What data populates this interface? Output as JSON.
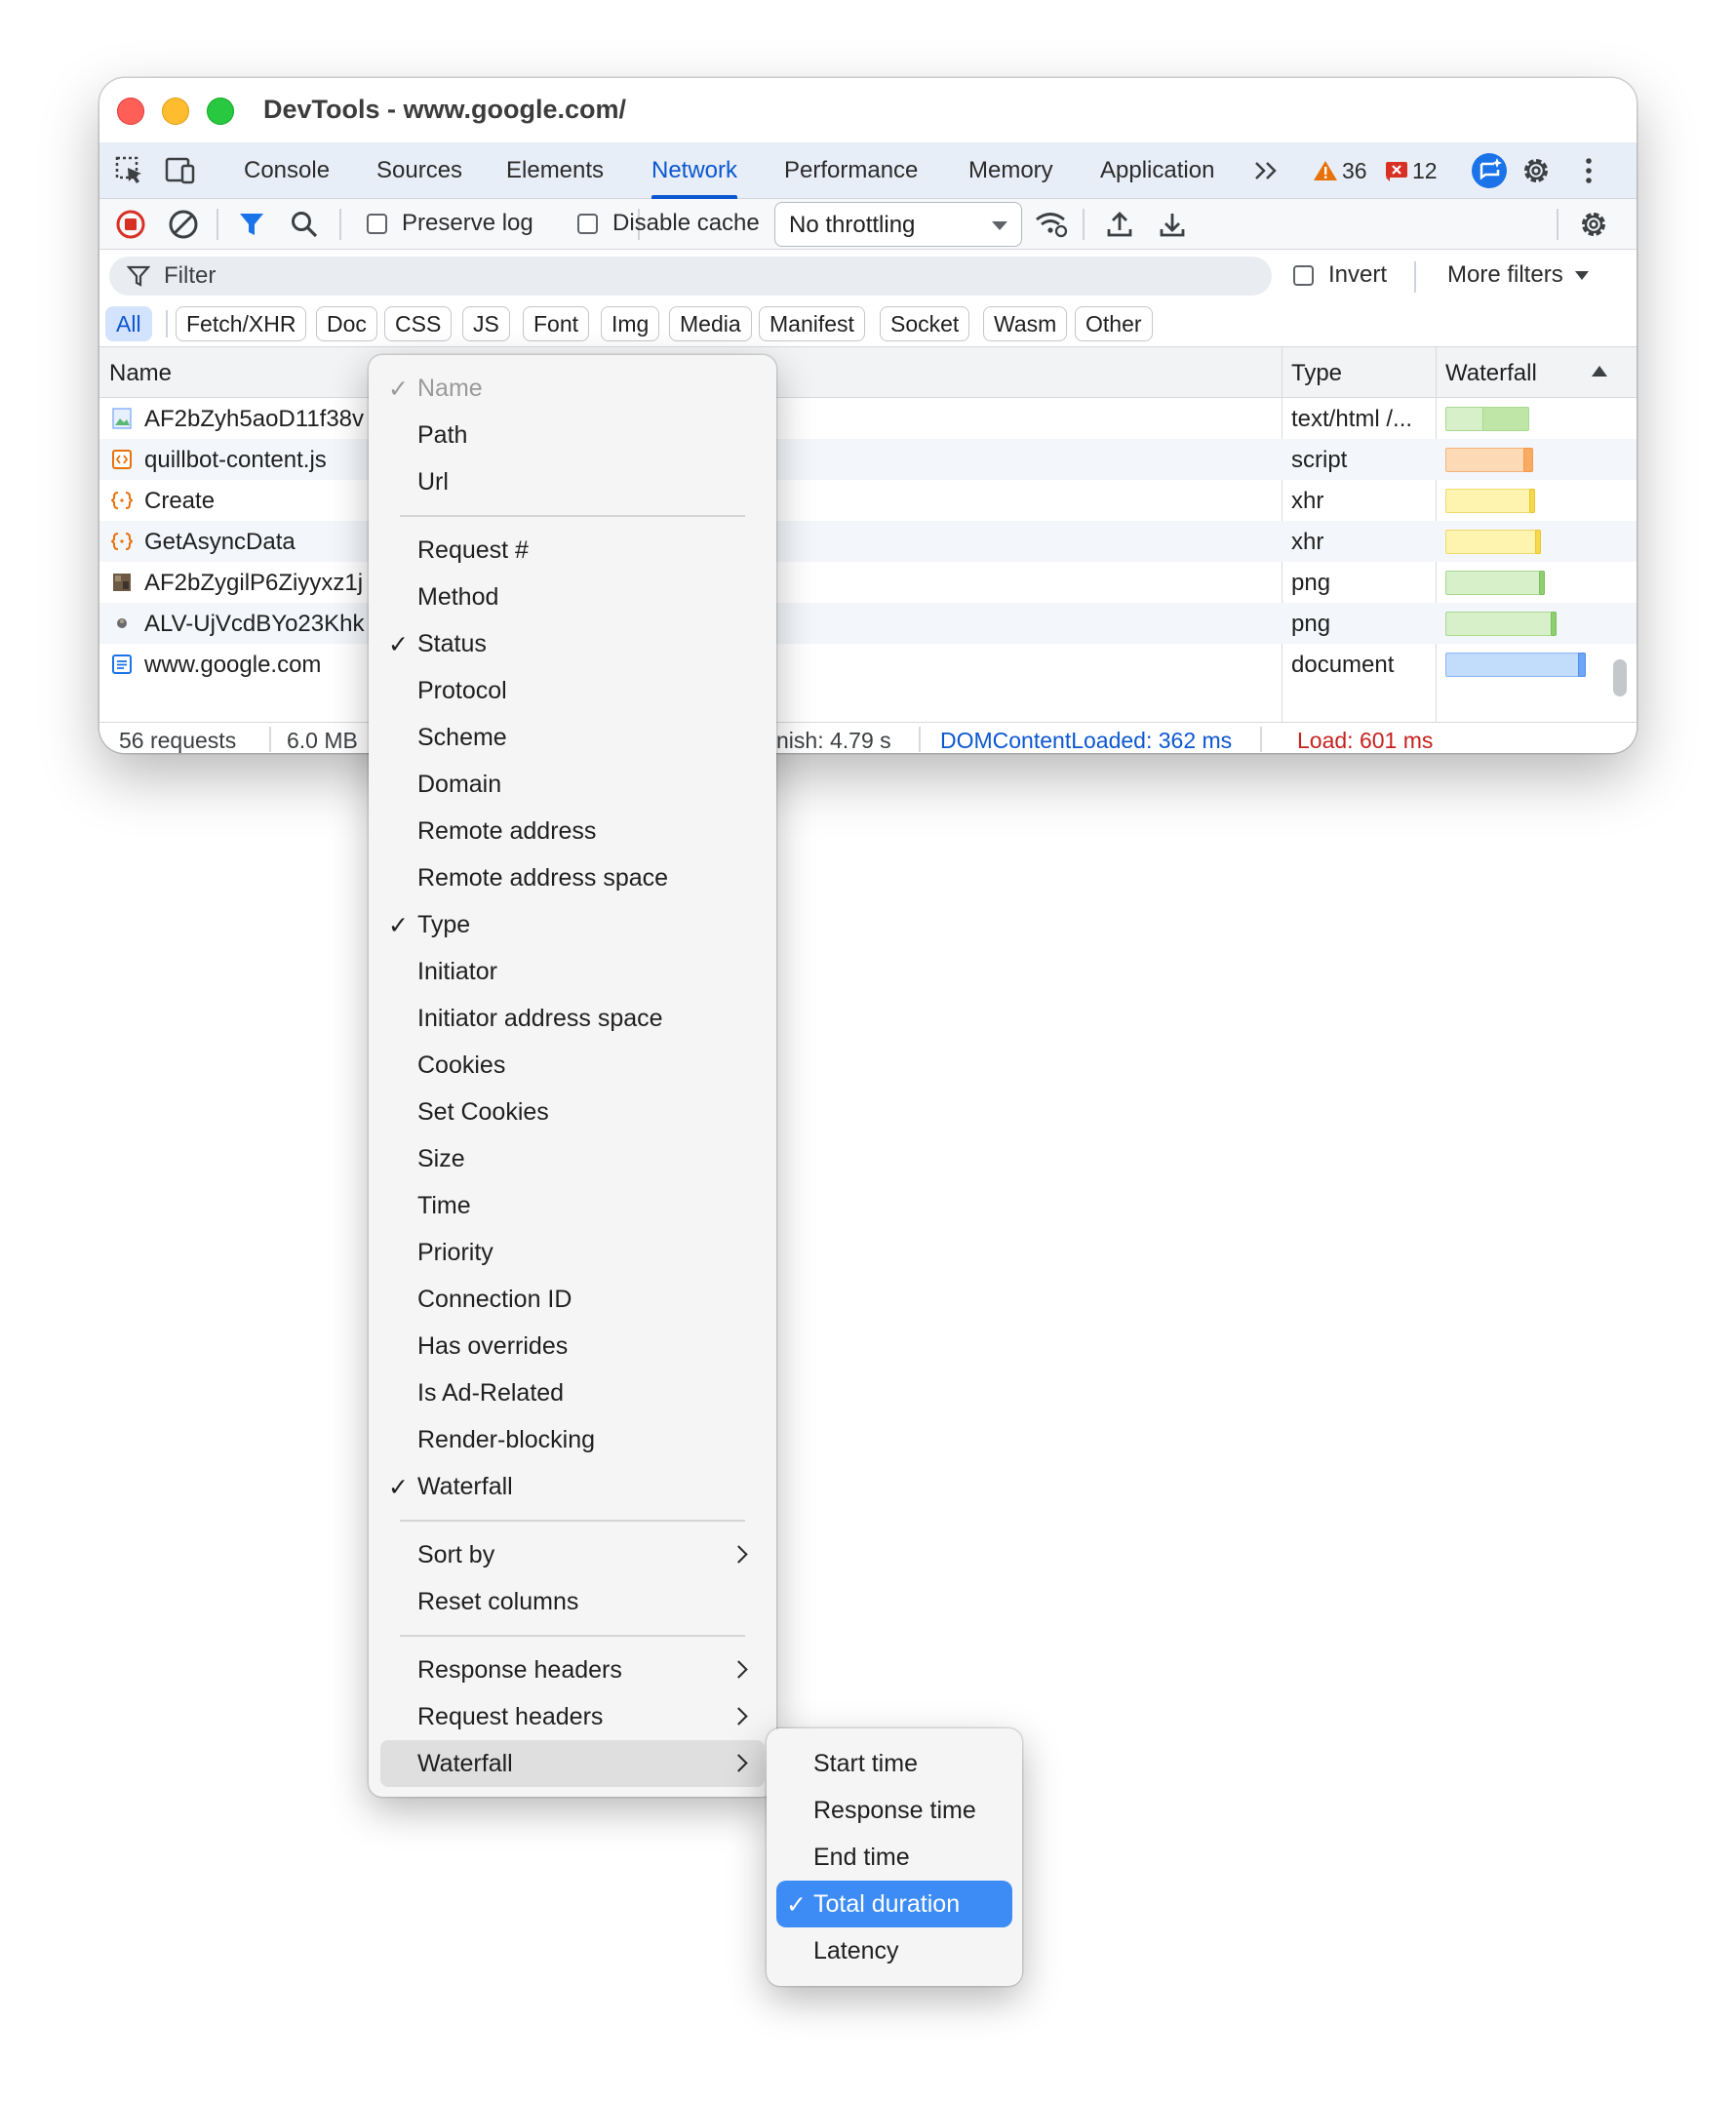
{
  "window": {
    "title": "DevTools - www.google.com/"
  },
  "tabs": [
    {
      "label": "Console",
      "active": false
    },
    {
      "label": "Sources",
      "active": false
    },
    {
      "label": "Elements",
      "active": false
    },
    {
      "label": "Network",
      "active": true
    },
    {
      "label": "Performance",
      "active": false
    },
    {
      "label": "Memory",
      "active": false
    },
    {
      "label": "Application",
      "active": false
    }
  ],
  "badges": {
    "warnings": "36",
    "errors": "12"
  },
  "toolbar": {
    "preserve_log": "Preserve log",
    "disable_cache": "Disable cache",
    "throttling": "No throttling"
  },
  "filter": {
    "placeholder": "Filter",
    "invert": "Invert",
    "more_filters": "More filters"
  },
  "chips": [
    "All",
    "Fetch/XHR",
    "Doc",
    "CSS",
    "JS",
    "Font",
    "Img",
    "Media",
    "Manifest",
    "Socket",
    "Wasm",
    "Other"
  ],
  "columns": {
    "name": "Name",
    "type": "Type",
    "waterfall": "Waterfall"
  },
  "rows": [
    {
      "name": "AF2bZyh5aoD11f38v",
      "type": "text/html /...",
      "icon": "image-file-icon"
    },
    {
      "name": "quillbot-content.js",
      "type": "script",
      "icon": "script-file-icon"
    },
    {
      "name": "Create",
      "type": "xhr",
      "icon": "xhr-icon"
    },
    {
      "name": "GetAsyncData",
      "type": "xhr",
      "icon": "xhr-icon"
    },
    {
      "name": "AF2bZygilP6Ziyyxz1j",
      "type": "png",
      "icon": "image-thumbnail-icon"
    },
    {
      "name": "ALV-UjVcdBYo23Khk",
      "type": "png",
      "icon": "image-thumbnail-icon"
    },
    {
      "name": "www.google.com",
      "type": "document",
      "icon": "document-icon"
    }
  ],
  "status": {
    "requests": "56 requests",
    "size": "6.0 MB",
    "finish": "nish: 4.79 s",
    "dom_content_loaded": "DOMContentLoaded: 362 ms",
    "load": "Load: 601 ms"
  },
  "context_menu": {
    "items": [
      {
        "label": "Name",
        "checked": true,
        "disabled": true
      },
      {
        "label": "Path"
      },
      {
        "label": "Url"
      },
      {
        "label": "Request #"
      },
      {
        "label": "Method"
      },
      {
        "label": "Status",
        "checked": true
      },
      {
        "label": "Protocol"
      },
      {
        "label": "Scheme"
      },
      {
        "label": "Domain"
      },
      {
        "label": "Remote address"
      },
      {
        "label": "Remote address space"
      },
      {
        "label": "Type",
        "checked": true
      },
      {
        "label": "Initiator"
      },
      {
        "label": "Initiator address space"
      },
      {
        "label": "Cookies"
      },
      {
        "label": "Set Cookies"
      },
      {
        "label": "Size"
      },
      {
        "label": "Time"
      },
      {
        "label": "Priority"
      },
      {
        "label": "Connection ID"
      },
      {
        "label": "Has overrides"
      },
      {
        "label": "Is Ad-Related"
      },
      {
        "label": "Render-blocking"
      },
      {
        "label": "Waterfall",
        "checked": true
      },
      {
        "label": "Sort by",
        "submenu": true
      },
      {
        "label": "Reset columns"
      },
      {
        "label": "Response headers",
        "submenu": true
      },
      {
        "label": "Request headers",
        "submenu": true
      },
      {
        "label": "Waterfall",
        "submenu": true,
        "highlighted": true
      }
    ]
  },
  "waterfall_submenu": {
    "items": [
      {
        "label": "Start time"
      },
      {
        "label": "Response time"
      },
      {
        "label": "End time"
      },
      {
        "label": "Total duration",
        "checked": true,
        "selected": true
      },
      {
        "label": "Latency"
      }
    ]
  },
  "colors": {
    "accent": "#0b57d0",
    "selected_item": "#3d8cf5",
    "warning": "#e8710a",
    "error": "#d93025",
    "record_stop": "#d93025",
    "load_text": "#c5221f"
  }
}
